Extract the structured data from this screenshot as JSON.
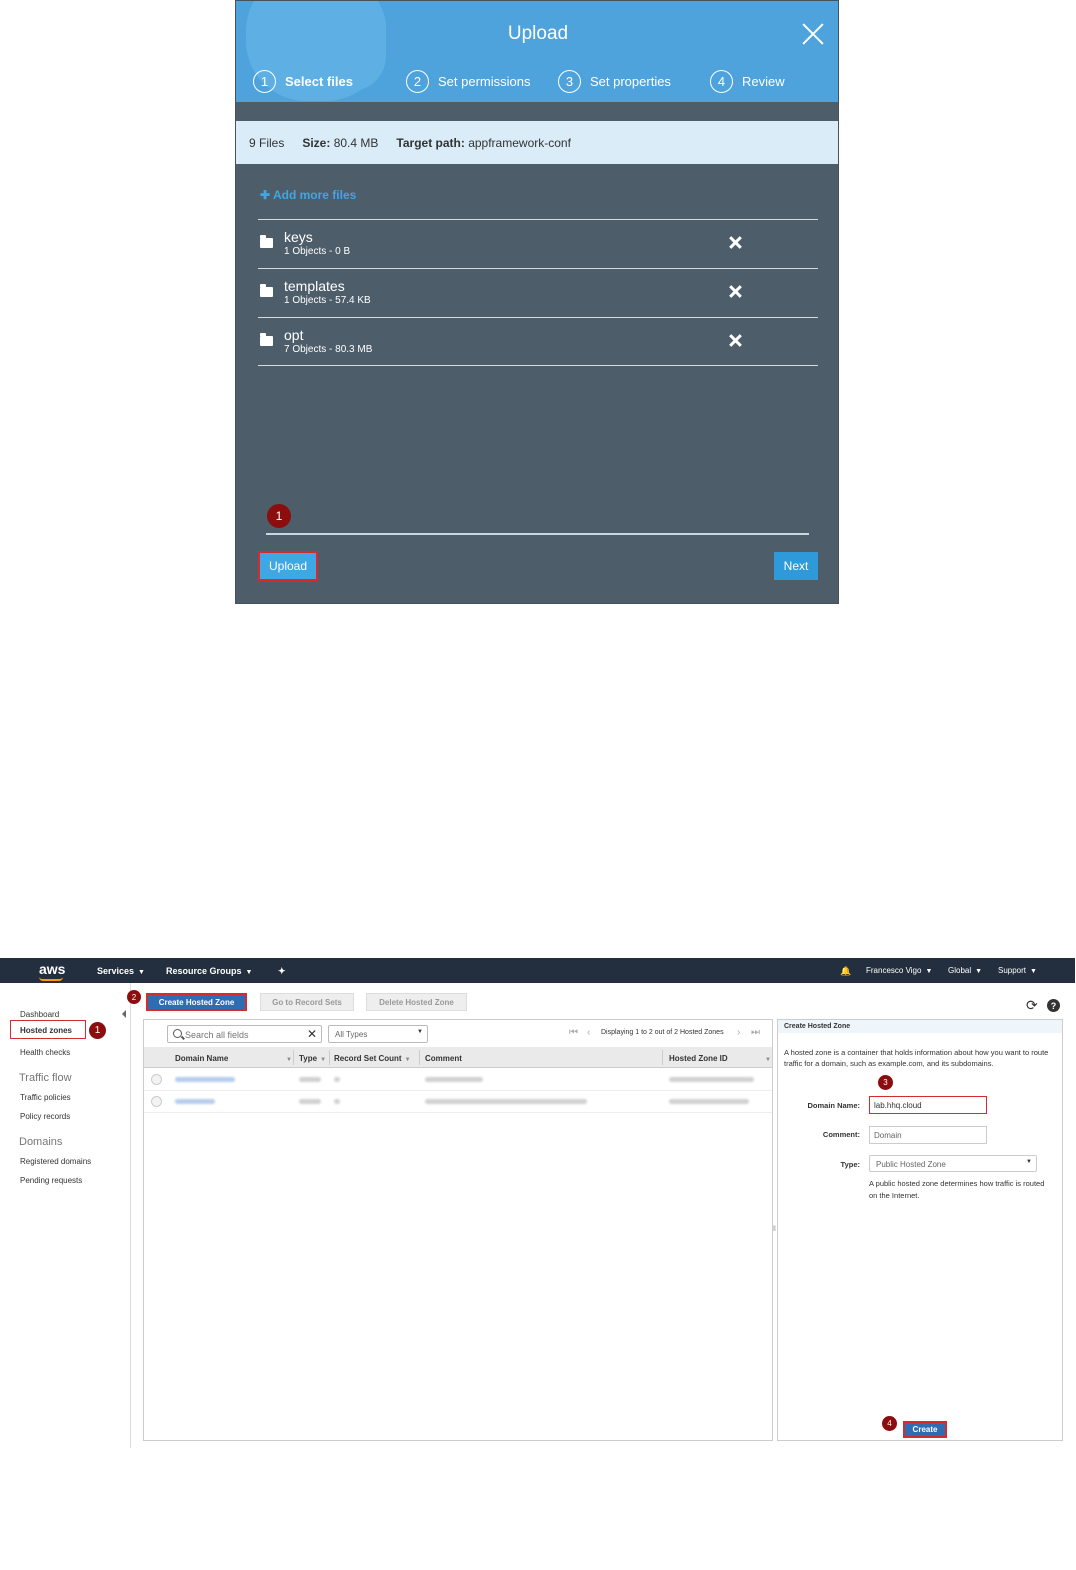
{
  "upload_dialog": {
    "title": "Upload",
    "steps": [
      {
        "num": "1",
        "label": "Select files"
      },
      {
        "num": "2",
        "label": "Set permissions"
      },
      {
        "num": "3",
        "label": "Set properties"
      },
      {
        "num": "4",
        "label": "Review"
      }
    ],
    "summary": {
      "files": "9 Files",
      "size_label": "Size:",
      "size_value": "80.4 MB",
      "target_label": "Target path:",
      "target_value": "appframework-conf"
    },
    "add_more_label": "Add more files",
    "add_more_icon": "plus-icon",
    "items": [
      {
        "name": "keys",
        "meta": "1 Objects - 0 B"
      },
      {
        "name": "templates",
        "meta": "1 Objects - 57.4 KB"
      },
      {
        "name": "opt",
        "meta": "7 Objects - 80.3 MB"
      }
    ],
    "badge": "1",
    "upload_label": "Upload",
    "next_label": "Next"
  },
  "console": {
    "logo": "aws",
    "nav": {
      "services": "Services",
      "resource_groups": "Resource Groups",
      "user": "Francesco Vigo",
      "region": "Global",
      "support": "Support"
    },
    "sidebar": {
      "dashboard": "Dashboard",
      "hosted_zones": "Hosted zones",
      "health_checks": "Health checks",
      "traffic_flow_head": "Traffic flow",
      "traffic_policies": "Traffic policies",
      "policy_records": "Policy records",
      "domains_head": "Domains",
      "registered_domains": "Registered domains",
      "pending_requests": "Pending requests"
    },
    "badges": {
      "b1": "1",
      "b2": "2",
      "b3": "3",
      "b4": "4"
    },
    "toolbar": {
      "create": "Create Hosted Zone",
      "goto": "Go to Record Sets",
      "delete": "Delete Hosted Zone"
    },
    "search_placeholder": "Search all fields",
    "type_filter": "All Types",
    "pager_text": "Displaying 1 to 2 out of 2 Hosted Zones",
    "columns": [
      "Domain Name",
      "Type",
      "Record Set Count",
      "Comment",
      "Hosted Zone ID"
    ],
    "form": {
      "title": "Create Hosted Zone",
      "description": "A hosted zone is a container that holds information about how you want to route traffic for a domain, such as example.com, and its subdomains.",
      "domain_label": "Domain Name:",
      "domain_value": "lab.hhq.cloud",
      "comment_label": "Comment:",
      "comment_value": "Domain",
      "type_label": "Type:",
      "type_value": "Public Hosted Zone",
      "type_help": "A public hosted zone determines how traffic is routed on the Internet.",
      "create_label": "Create"
    },
    "colors": {
      "navbar": "#232f3e",
      "primary_button": "#2e6db4",
      "highlight": "#d42b2b",
      "badge": "#8b0d0d"
    }
  }
}
